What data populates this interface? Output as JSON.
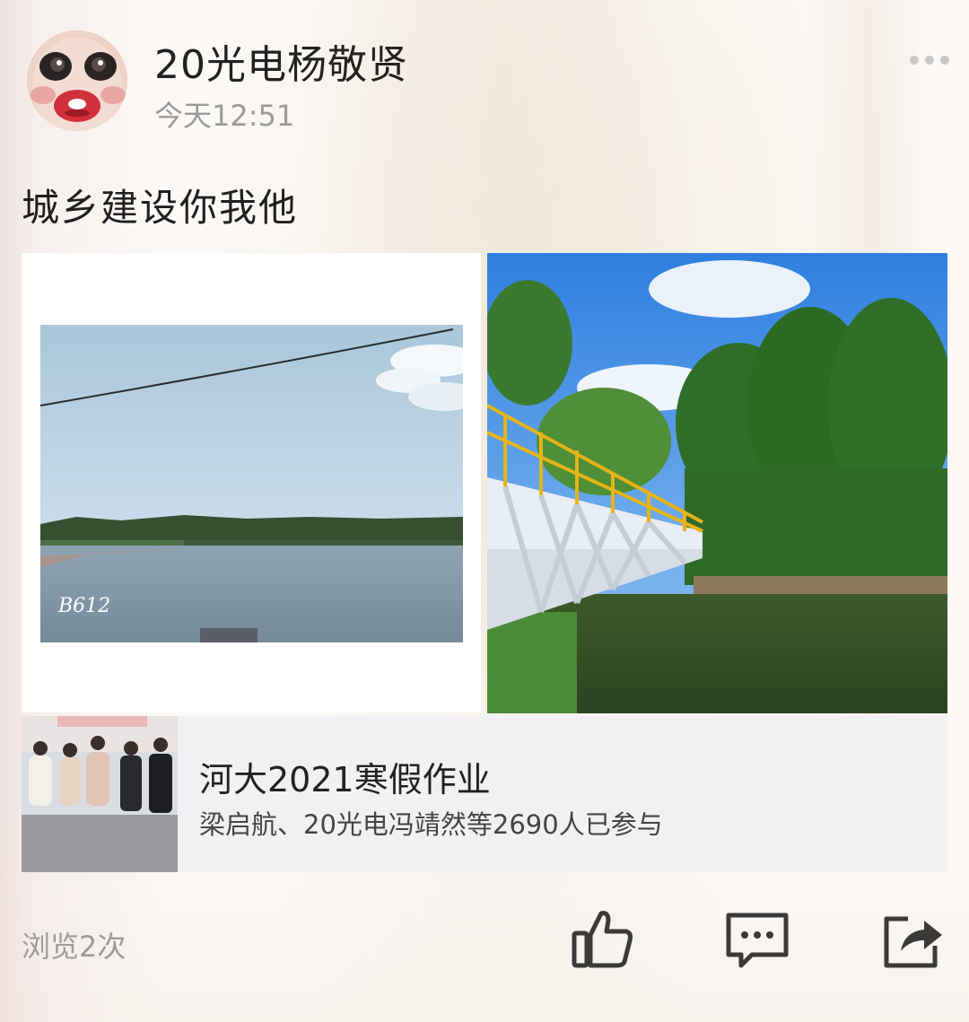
{
  "post": {
    "author": "20光电杨敬贤",
    "time": "今天12:51",
    "text": "城乡建设你我他",
    "photos": [
      {
        "name": "lake-photo",
        "watermark": "B612"
      },
      {
        "name": "bridge-photo"
      }
    ]
  },
  "topic": {
    "title": "河大2021寒假作业",
    "participants": "梁启航、20光电冯靖然等2690人已参与"
  },
  "footer": {
    "views": "浏览2次"
  },
  "icons": {
    "more": "more-dots-icon",
    "like": "thumbs-up-icon",
    "comment": "comment-bubble-icon",
    "share": "share-arrow-icon"
  },
  "colors": {
    "icon": "#3a3a3a",
    "muted_text": "#9b9b9b",
    "card_bg": "#f1f1f3"
  }
}
